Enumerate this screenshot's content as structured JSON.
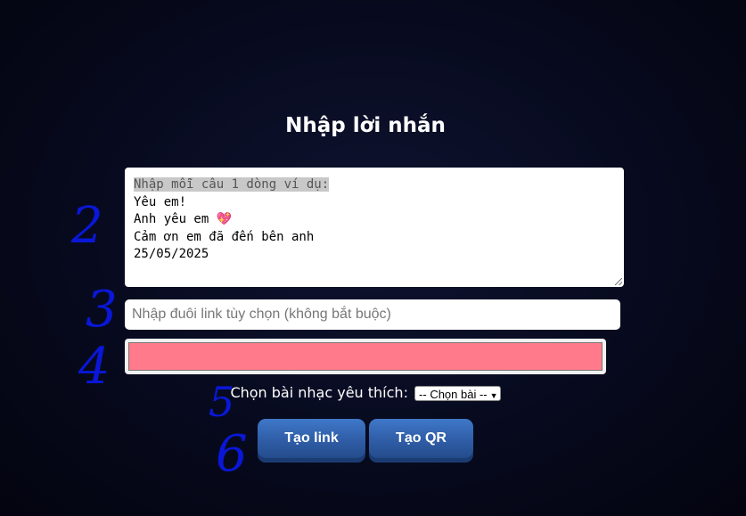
{
  "page": {
    "title": "Nhập lời nhắn"
  },
  "message_box": {
    "hint": "Nhập mỗi câu 1 dòng ví dụ:",
    "lines": [
      "Yêu em!",
      "Anh yêu em",
      "Cảm ơn em đã đến bên anh",
      "25/05/2025"
    ],
    "heart_glyph": "💖"
  },
  "link_input": {
    "placeholder": "Nhập đuôi link tùy chọn (không bắt buộc)"
  },
  "color_picker": {
    "value": "#ff7a8a"
  },
  "music": {
    "label": "Chọn bài nhạc yêu thích:",
    "selected": "-- Chọn bài --"
  },
  "buttons": {
    "create_link": "Tạo link",
    "create_qr": "Tạo QR"
  },
  "annotations": [
    "2",
    "3",
    "4",
    "5",
    "6"
  ]
}
